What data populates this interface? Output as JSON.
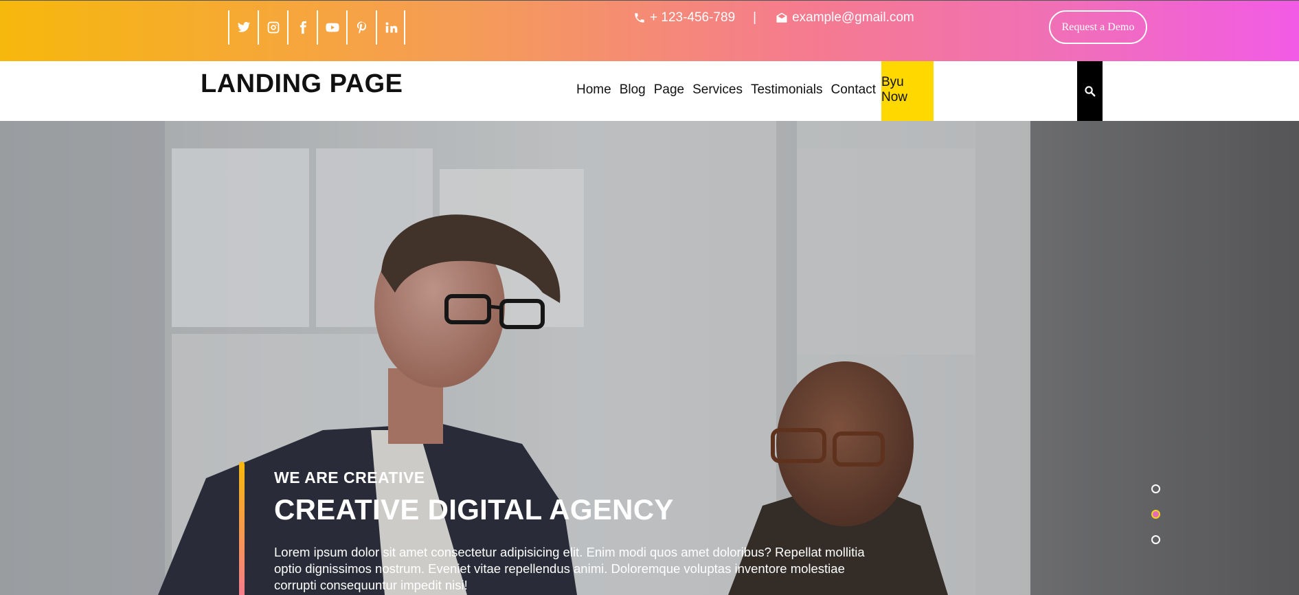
{
  "topbar": {
    "socials": [
      {
        "icon": "twitter-icon"
      },
      {
        "icon": "instagram-icon"
      },
      {
        "icon": "facebook-icon"
      },
      {
        "icon": "youtube-icon"
      },
      {
        "icon": "pinterest-icon"
      },
      {
        "icon": "linkedin-icon"
      }
    ],
    "phone": "+ 123-456-789",
    "separator": "|",
    "email": "example@gmail.com",
    "demo_button": "Request a Demo"
  },
  "navbar": {
    "logo": "LANDING PAGE",
    "menu": [
      "Home",
      "Blog",
      "Page",
      "Services",
      "Testimonials",
      "Contact",
      "Byu Now"
    ],
    "search_icon": "search-icon"
  },
  "hero": {
    "kicker": "WE ARE CREATIVE",
    "headline": "CREATIVE DIGITAL AGENCY",
    "description": "Lorem ipsum dolor sit amet consectetur adipisicing elit. Enim modi quos amet doloribus? Repellat mollitia optio dignissimos nostrum. Eveniet vitae repellendus animi. Doloremque voluptas inventore molestiae corrupti consequuntur impedit nisi!",
    "slides": 3,
    "active_slide": 2
  },
  "colors": {
    "gradient_start": "#f7b80c",
    "gradient_end": "#f25be6",
    "buy_now_bg": "#ffd800",
    "search_bg": "#000000"
  }
}
